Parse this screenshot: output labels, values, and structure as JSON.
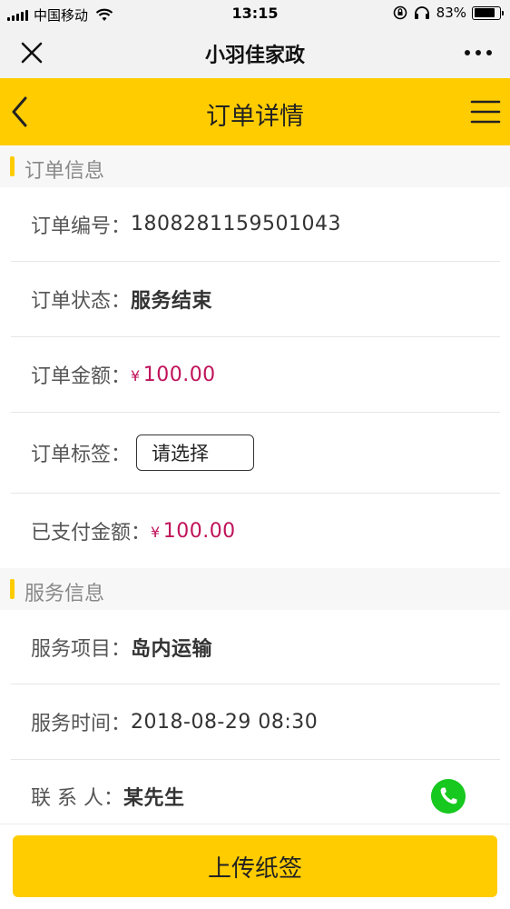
{
  "status_bar": {
    "carrier": "中国移动",
    "time": "13:15",
    "battery_percent": "83%",
    "battery_level": 0.83
  },
  "wechat_nav": {
    "title": "小羽佳家政",
    "close_icon": "close-icon",
    "more_icon": "more-dots-icon"
  },
  "header": {
    "title": "订单详情",
    "back_icon": "chevron-left-icon",
    "menu_icon": "hamburger-menu-icon",
    "accent_color": "#ffcc00"
  },
  "order_section": {
    "title": "订单信息",
    "order_no_label": "订单编号：",
    "order_no": "1808281159501043",
    "status_label": "订单状态：",
    "status": "服务结束",
    "amount_label": "订单金额：",
    "amount_currency": "¥",
    "amount": "100.00",
    "tag_label": "订单标签：",
    "tag_placeholder": "请选择",
    "paid_label": "已支付金额：",
    "paid_currency": "¥",
    "paid": "100.00",
    "money_color": "#c0135a"
  },
  "service_section": {
    "title": "服务信息",
    "item_label": "服务项目：",
    "item": "岛内运输",
    "time_label": "服务时间：",
    "time": "2018-08-29 08:30",
    "contact_label": "联 系 人：",
    "contact": "某先生",
    "phone_icon": "phone-call-icon",
    "phone_color": "#17c81f"
  },
  "footer": {
    "upload_label": "上传纸签"
  }
}
